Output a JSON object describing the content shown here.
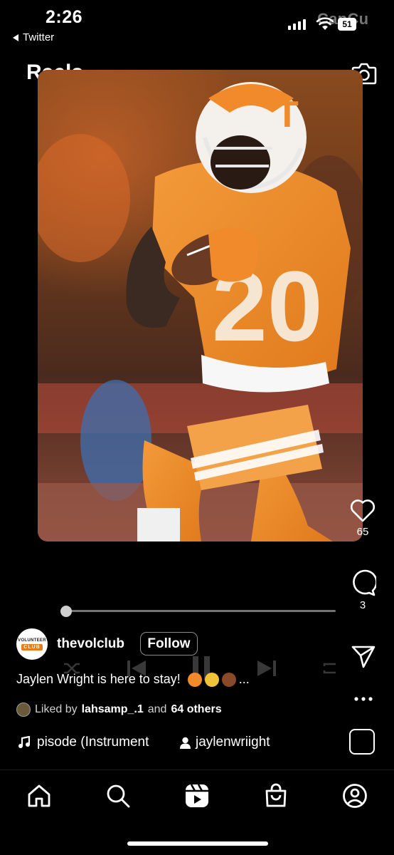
{
  "status_bar": {
    "time": "2:26",
    "back_label": "Twitter",
    "battery": "51",
    "watermark": "CapCu"
  },
  "header": {
    "title": "Reels"
  },
  "actions": {
    "likes": "65",
    "comments": "3"
  },
  "post": {
    "username": "thevolclub",
    "follow_label": "Follow",
    "avatar_text_top": "VOLUNTEER",
    "avatar_text_bottom": "CLUB",
    "caption": "Jaylen Wright is here to stay!",
    "caption_more": "...",
    "liked_prefix": "Liked by",
    "liked_user": "lahsamp_.1",
    "liked_and": "and",
    "liked_others": "64 others",
    "audio": "pisode (Instrument",
    "creator": "jaylenwriight"
  },
  "playback": {
    "progress": 0.0
  },
  "colors": {
    "accent_orange": "#e87b1c",
    "background": "#000000"
  },
  "icons": [
    "camera-icon",
    "heart-icon",
    "comment-icon",
    "share-icon",
    "more-icon",
    "music-icon",
    "person-icon",
    "home-icon",
    "search-icon",
    "reels-icon",
    "shop-icon",
    "profile-icon"
  ]
}
